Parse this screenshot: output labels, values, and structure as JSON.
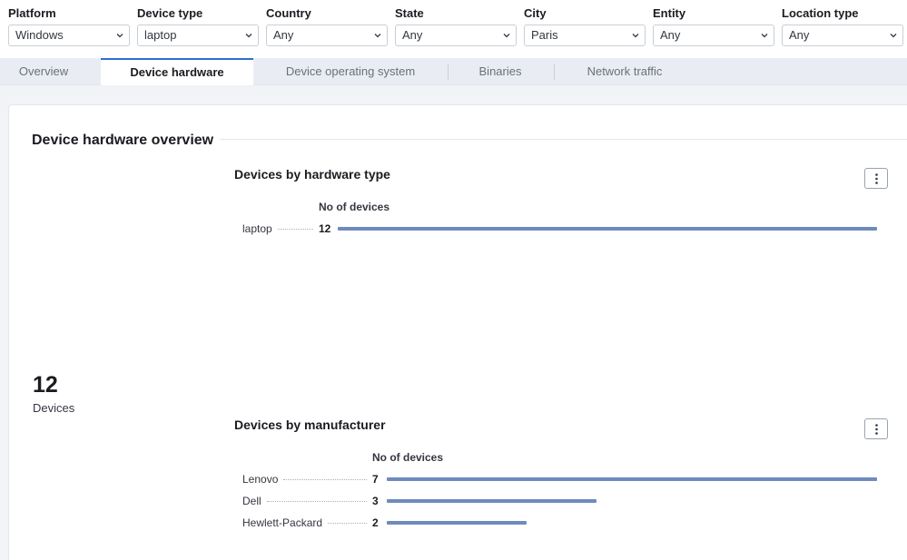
{
  "filters": [
    {
      "label": "Platform",
      "value": "Windows"
    },
    {
      "label": "Device type",
      "value": "laptop"
    },
    {
      "label": "Country",
      "value": "Any"
    },
    {
      "label": "State",
      "value": "Any"
    },
    {
      "label": "City",
      "value": "Paris"
    },
    {
      "label": "Entity",
      "value": "Any"
    },
    {
      "label": "Location type",
      "value": "Any"
    }
  ],
  "tabs": [
    {
      "label": "Overview"
    },
    {
      "label": "Device hardware"
    },
    {
      "label": "Device operating system"
    },
    {
      "label": "Binaries"
    },
    {
      "label": "Network traffic"
    }
  ],
  "active_tab": "Device hardware",
  "section": {
    "title": "Device hardware overview"
  },
  "metric": {
    "value": "12",
    "label": "Devices"
  },
  "charts": {
    "hardware_type": {
      "title": "Devices by hardware type",
      "column_header": "No of devices",
      "rows": [
        {
          "label": "laptop",
          "value": 12
        }
      ],
      "max": 12
    },
    "manufacturer": {
      "title": "Devices by manufacturer",
      "column_header": "No of devices",
      "rows": [
        {
          "label": "Lenovo",
          "value": 7
        },
        {
          "label": "Dell",
          "value": 3
        },
        {
          "label": "Hewlett-Packard",
          "value": 2
        }
      ],
      "max": 7
    }
  },
  "colors": {
    "bar": "#6e8bbb",
    "accent": "#2f6fcf"
  }
}
